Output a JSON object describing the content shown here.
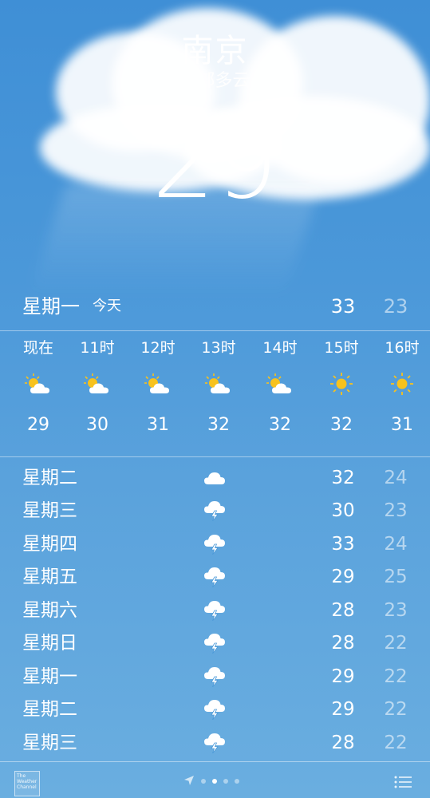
{
  "location": {
    "city": "南京",
    "condition": "局部多云",
    "current_temp": "29"
  },
  "today": {
    "day": "星期一",
    "label": "今天",
    "high": "33",
    "low": "23"
  },
  "hourly": [
    {
      "time": "现在",
      "icon": "partly-cloudy-sun-icon",
      "temp": "29"
    },
    {
      "time": "11时",
      "icon": "partly-cloudy-sun-icon",
      "temp": "30"
    },
    {
      "time": "12时",
      "icon": "partly-cloudy-sun-icon",
      "temp": "31"
    },
    {
      "time": "13时",
      "icon": "partly-cloudy-sun-icon",
      "temp": "32"
    },
    {
      "time": "14时",
      "icon": "partly-cloudy-sun-icon",
      "temp": "32"
    },
    {
      "time": "15时",
      "icon": "sun-icon",
      "temp": "32"
    },
    {
      "time": "16时",
      "icon": "sun-icon",
      "temp": "31"
    }
  ],
  "daily": [
    {
      "day": "星期二",
      "icon": "cloud-icon",
      "high": "32",
      "low": "24"
    },
    {
      "day": "星期三",
      "icon": "thunderstorm-icon",
      "high": "30",
      "low": "23"
    },
    {
      "day": "星期四",
      "icon": "thunderstorm-icon",
      "high": "33",
      "low": "24"
    },
    {
      "day": "星期五",
      "icon": "thunderstorm-icon",
      "high": "29",
      "low": "25"
    },
    {
      "day": "星期六",
      "icon": "thunderstorm-icon",
      "high": "28",
      "low": "23"
    },
    {
      "day": "星期日",
      "icon": "thunderstorm-icon",
      "high": "28",
      "low": "22"
    },
    {
      "day": "星期一",
      "icon": "thunderstorm-icon",
      "high": "29",
      "low": "22"
    },
    {
      "day": "星期二",
      "icon": "thunderstorm-icon",
      "high": "29",
      "low": "22"
    },
    {
      "day": "星期三",
      "icon": "thunderstorm-icon",
      "high": "28",
      "low": "22"
    }
  ],
  "footer": {
    "logo_text": "The Weather Channel",
    "page_count": 4,
    "active_page": 1
  },
  "colors": {
    "sun": "#f7c21d",
    "sky_top": "#3f8fd6",
    "sky_bottom": "#6aaee0"
  }
}
